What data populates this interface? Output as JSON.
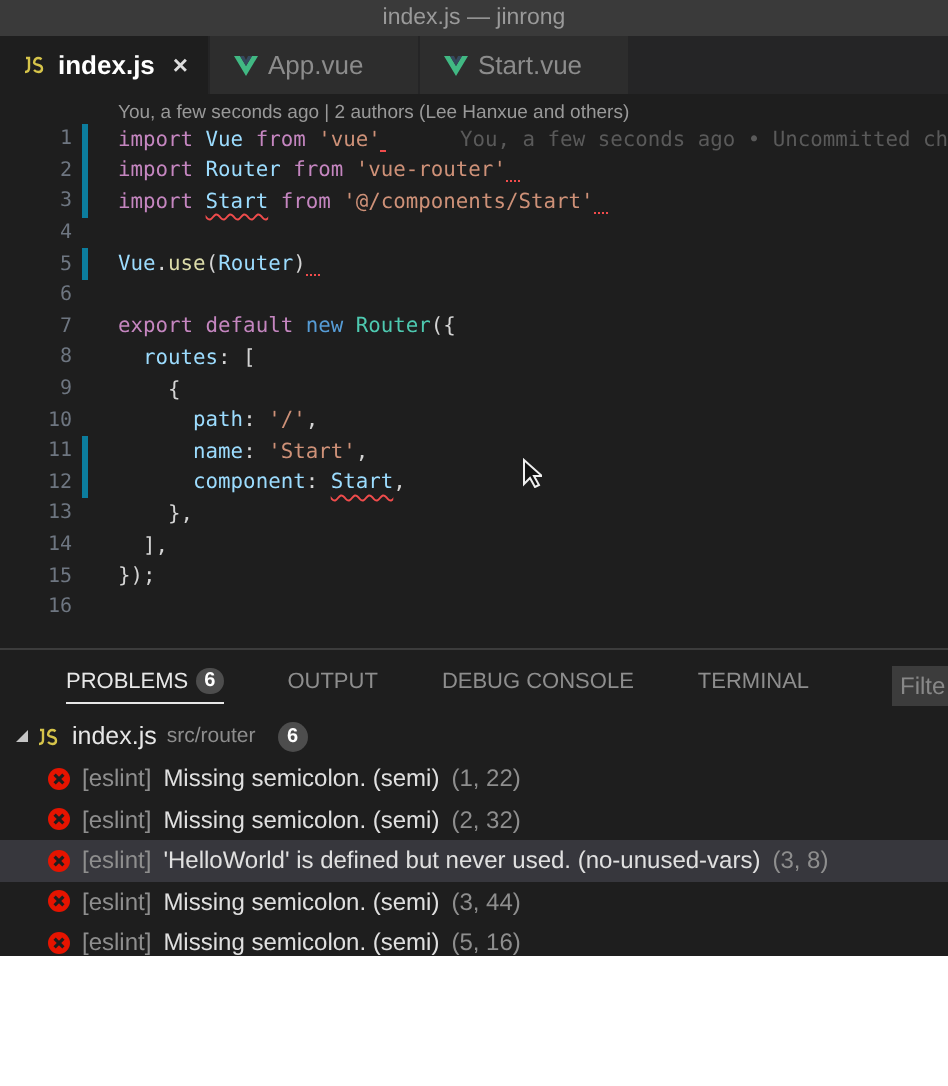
{
  "window": {
    "title": "index.js — jinrong"
  },
  "tabs": [
    {
      "label": "index.js",
      "selected": true,
      "close": "×"
    },
    {
      "label": "App.vue",
      "selected": false
    },
    {
      "label": "Start.vue",
      "selected": false
    }
  ],
  "editor": {
    "codelens": "You, a few seconds ago | 2 authors (Lee Hanxue and others)",
    "lines": [
      {
        "number": "1",
        "modified": true,
        "semicolon_error": true,
        "blame": "You, a few seconds ago • Uncommitted ch",
        "tokens": [
          {
            "kind": "keyword",
            "text": "import "
          },
          {
            "kind": "ident",
            "text": "Vue "
          },
          {
            "kind": "keyword",
            "text": "from "
          },
          {
            "kind": "string",
            "text": "'vue'"
          }
        ]
      },
      {
        "number": "2",
        "modified": true,
        "semicolon_error": true,
        "tokens": [
          {
            "kind": "keyword",
            "text": "import "
          },
          {
            "kind": "ident",
            "text": "Router "
          },
          {
            "kind": "keyword",
            "text": "from "
          },
          {
            "kind": "string",
            "text": "'vue-router'"
          }
        ]
      },
      {
        "number": "3",
        "modified": true,
        "semicolon_error": true,
        "tokens": [
          {
            "kind": "keyword",
            "text": "import "
          },
          {
            "kind": "ident",
            "text": "Start",
            "error": true
          },
          {
            "kind": "keyword",
            "text": " from "
          },
          {
            "kind": "string",
            "text": "'@/components/Start'"
          }
        ]
      },
      {
        "number": "4",
        "modified": false,
        "semicolon_error": false
      },
      {
        "number": "5",
        "modified": true,
        "semicolon_error": true,
        "tokens": [
          {
            "kind": "ident",
            "text": "Vue"
          },
          {
            "kind": "plain",
            "text": "."
          },
          {
            "kind": "func",
            "text": "use"
          },
          {
            "kind": "plain",
            "text": "("
          },
          {
            "kind": "ident",
            "text": "Router"
          },
          {
            "kind": "plain",
            "text": ")"
          }
        ]
      },
      {
        "number": "6",
        "modified": false,
        "semicolon_error": false
      },
      {
        "number": "7",
        "modified": false,
        "semicolon_error": false,
        "tokens": [
          {
            "kind": "keyword",
            "text": "export default "
          },
          {
            "kind": "storage",
            "text": "new "
          },
          {
            "kind": "class",
            "text": "Router"
          },
          {
            "kind": "plain",
            "text": "({"
          }
        ]
      },
      {
        "number": "8",
        "modified": false,
        "semicolon_error": false,
        "tokens": [
          {
            "kind": "ident",
            "text": "  routes"
          },
          {
            "kind": "plain",
            "text": ": ["
          }
        ]
      },
      {
        "number": "9",
        "modified": false,
        "semicolon_error": false,
        "tokens": [
          {
            "kind": "plain",
            "text": "    {"
          }
        ]
      },
      {
        "number": "10",
        "modified": false,
        "semicolon_error": false,
        "tokens": [
          {
            "kind": "ident",
            "text": "      path"
          },
          {
            "kind": "plain",
            "text": ": "
          },
          {
            "kind": "string",
            "text": "'/'"
          },
          {
            "kind": "plain",
            "text": ","
          }
        ]
      },
      {
        "number": "11",
        "modified": true,
        "semicolon_error": false,
        "tokens": [
          {
            "kind": "ident",
            "text": "      name"
          },
          {
            "kind": "plain",
            "text": ": "
          },
          {
            "kind": "string",
            "text": "'Start'"
          },
          {
            "kind": "plain",
            "text": ","
          }
        ]
      },
      {
        "number": "12",
        "modified": true,
        "semicolon_error": false,
        "tokens": [
          {
            "kind": "ident",
            "text": "      component"
          },
          {
            "kind": "plain",
            "text": ": "
          },
          {
            "kind": "ident",
            "text": "Start",
            "error": true
          },
          {
            "kind": "plain",
            "text": ","
          }
        ]
      },
      {
        "number": "13",
        "modified": false,
        "semicolon_error": false,
        "tokens": [
          {
            "kind": "plain",
            "text": "    },"
          }
        ]
      },
      {
        "number": "14",
        "modified": false,
        "semicolon_error": false,
        "tokens": [
          {
            "kind": "plain",
            "text": "  ],"
          }
        ]
      },
      {
        "number": "15",
        "modified": false,
        "semicolon_error": false,
        "tokens": [
          {
            "kind": "plain",
            "text": "});"
          }
        ]
      },
      {
        "number": "16",
        "modified": false,
        "semicolon_error": false
      }
    ]
  },
  "panel": {
    "tabs": [
      {
        "label": "PROBLEMS",
        "badge": "6",
        "selected": true
      },
      {
        "label": "OUTPUT",
        "selected": false
      },
      {
        "label": "DEBUG CONSOLE",
        "selected": false
      },
      {
        "label": "TERMINAL",
        "selected": false
      }
    ],
    "filter": {
      "placeholder": "Filte"
    },
    "file": {
      "expanded": true,
      "name": "index.js",
      "path": "src/router",
      "count": "6"
    },
    "problems": [
      {
        "source": "[eslint]",
        "message": "Missing semicolon. (semi)",
        "position": "(1, 22)",
        "selected": false
      },
      {
        "source": "[eslint]",
        "message": "Missing semicolon. (semi)",
        "position": "(2, 32)",
        "selected": false
      },
      {
        "source": "[eslint]",
        "message": "'HelloWorld' is defined but never used. (no-unused-vars)",
        "position": "(3, 8)",
        "selected": true
      },
      {
        "source": "[eslint]",
        "message": "Missing semicolon. (semi)",
        "position": "(3, 44)",
        "selected": false
      },
      {
        "source": "[eslint]",
        "message": "Missing semicolon. (semi)",
        "position": "(5, 16)",
        "selected": false
      }
    ]
  }
}
